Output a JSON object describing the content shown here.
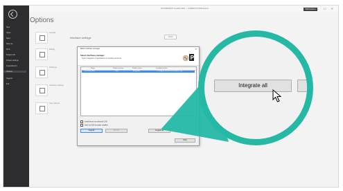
{
  "window": {
    "title": "SOLIDWORKS Visualize 2016 — CADENAS PARTsolutions",
    "brand": "PARTsolutions",
    "window_controls": "— ☐ ✕"
  },
  "sidebar": {
    "items": [
      {
        "label": "New"
      },
      {
        "label": "Open"
      },
      {
        "label": "Save"
      },
      {
        "label": "Save as"
      },
      {
        "label": "Print"
      },
      {
        "label": "Project info"
      },
      {
        "label": "Project settings"
      },
      {
        "label": "Import/Export"
      },
      {
        "label": "Options"
      },
      {
        "label": "Support"
      },
      {
        "label": "Exit"
      }
    ],
    "selected_index": 8
  },
  "page": {
    "heading": "Options",
    "categories": [
      {
        "label": "General"
      },
      {
        "label": "Editing"
      },
      {
        "label": "Drawings"
      },
      {
        "label": "Interfaces settings"
      },
      {
        "label": "User Options"
      }
    ],
    "panel_title": "Interface settings",
    "panel_button": "Check"
  },
  "dialog": {
    "title": "Batch interface manager",
    "close": "✕",
    "heading": "Select interfaces manager",
    "subheading": "Select integration of applications to interface accounts",
    "columns": [
      "Name",
      "Product version",
      "Product status",
      "Installed location"
    ],
    "rows": [
      {
        "name": "SOLIDWORKS",
        "version": "2016",
        "status": "Integrated",
        "location": "C:\\Program Files\\SOLIDWORKS Corp"
      }
    ],
    "checkboxes": [
      {
        "label": "Install driver into selected CAD"
      },
      {
        "label": "Save as CAD template installed"
      }
    ],
    "buttons": {
      "integrate": "Integrate",
      "remove": "Remove",
      "integrate_all": "Integrate all",
      "close": "Close"
    }
  },
  "magnifier": {
    "button_label": "Integrate all"
  },
  "colors": {
    "accent": "#25b8a5",
    "selection": "#3a8ee6",
    "sidebar": "#2d2d30"
  }
}
